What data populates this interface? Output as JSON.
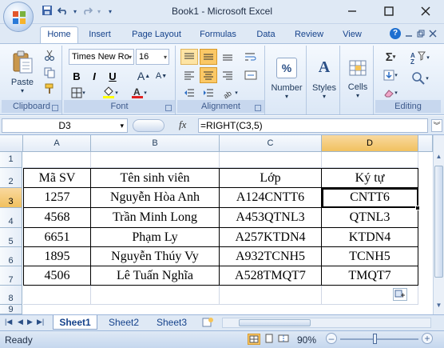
{
  "window": {
    "title": "Book1 - Microsoft Excel",
    "minimize": "–",
    "maximize": "□",
    "close": "✕"
  },
  "qat": [
    "💾",
    "↶",
    "▾",
    "↷",
    "▾",
    "▾"
  ],
  "tabs": [
    "Home",
    "Insert",
    "Page Layout",
    "Formulas",
    "Data",
    "Review",
    "View"
  ],
  "ribbon": {
    "clipboard": {
      "label": "Clipboard",
      "paste": "Paste"
    },
    "font": {
      "label": "Font",
      "font_name": "Times New Ro",
      "font_size": "16",
      "bold": "B",
      "italic": "I",
      "underline": "U",
      "grow": "A",
      "shrink": "A"
    },
    "alignment": {
      "label": "Alignment"
    },
    "number": {
      "label": "Number",
      "symbol": "%"
    },
    "styles": {
      "label": "Styles",
      "symbol": "A"
    },
    "cells": {
      "label": "Cells"
    },
    "editing": {
      "label": "Editing",
      "sum": "Σ"
    }
  },
  "formula_bar": {
    "name_box": "D3",
    "fx": "fx",
    "formula": "=RIGHT(C3,5)"
  },
  "grid": {
    "columns": [
      "A",
      "B",
      "C",
      "D"
    ],
    "rows": [
      "1",
      "2",
      "3",
      "4",
      "5",
      "6",
      "7",
      "8",
      "9"
    ],
    "headers": [
      "Mã SV",
      "Tên sinh viên",
      "Lớp",
      "Ký tự"
    ],
    "data": [
      [
        "1257",
        "Nguyễn Hòa Anh",
        "A124CNTT6",
        "CNTT6"
      ],
      [
        "4568",
        "Trần Minh Long",
        "A453QTNL3",
        "QTNL3"
      ],
      [
        "6651",
        "Phạm Ly",
        "A257KTDN4",
        "KTDN4"
      ],
      [
        "1895",
        "Nguyễn Thúy Vy",
        "A932TCNH5",
        "TCNH5"
      ],
      [
        "4506",
        "Lê Tuấn Nghĩa",
        "A528TMQT7",
        "TMQT7"
      ]
    ],
    "selected_cell": "D3"
  },
  "sheets": [
    "Sheet1",
    "Sheet2",
    "Sheet3"
  ],
  "status": {
    "ready": "Ready",
    "zoom": "90%",
    "zoom_level": 0.9
  },
  "colors": {
    "selected_header": "#f1c15f",
    "ribbon_bg": "#dbe7f6"
  }
}
